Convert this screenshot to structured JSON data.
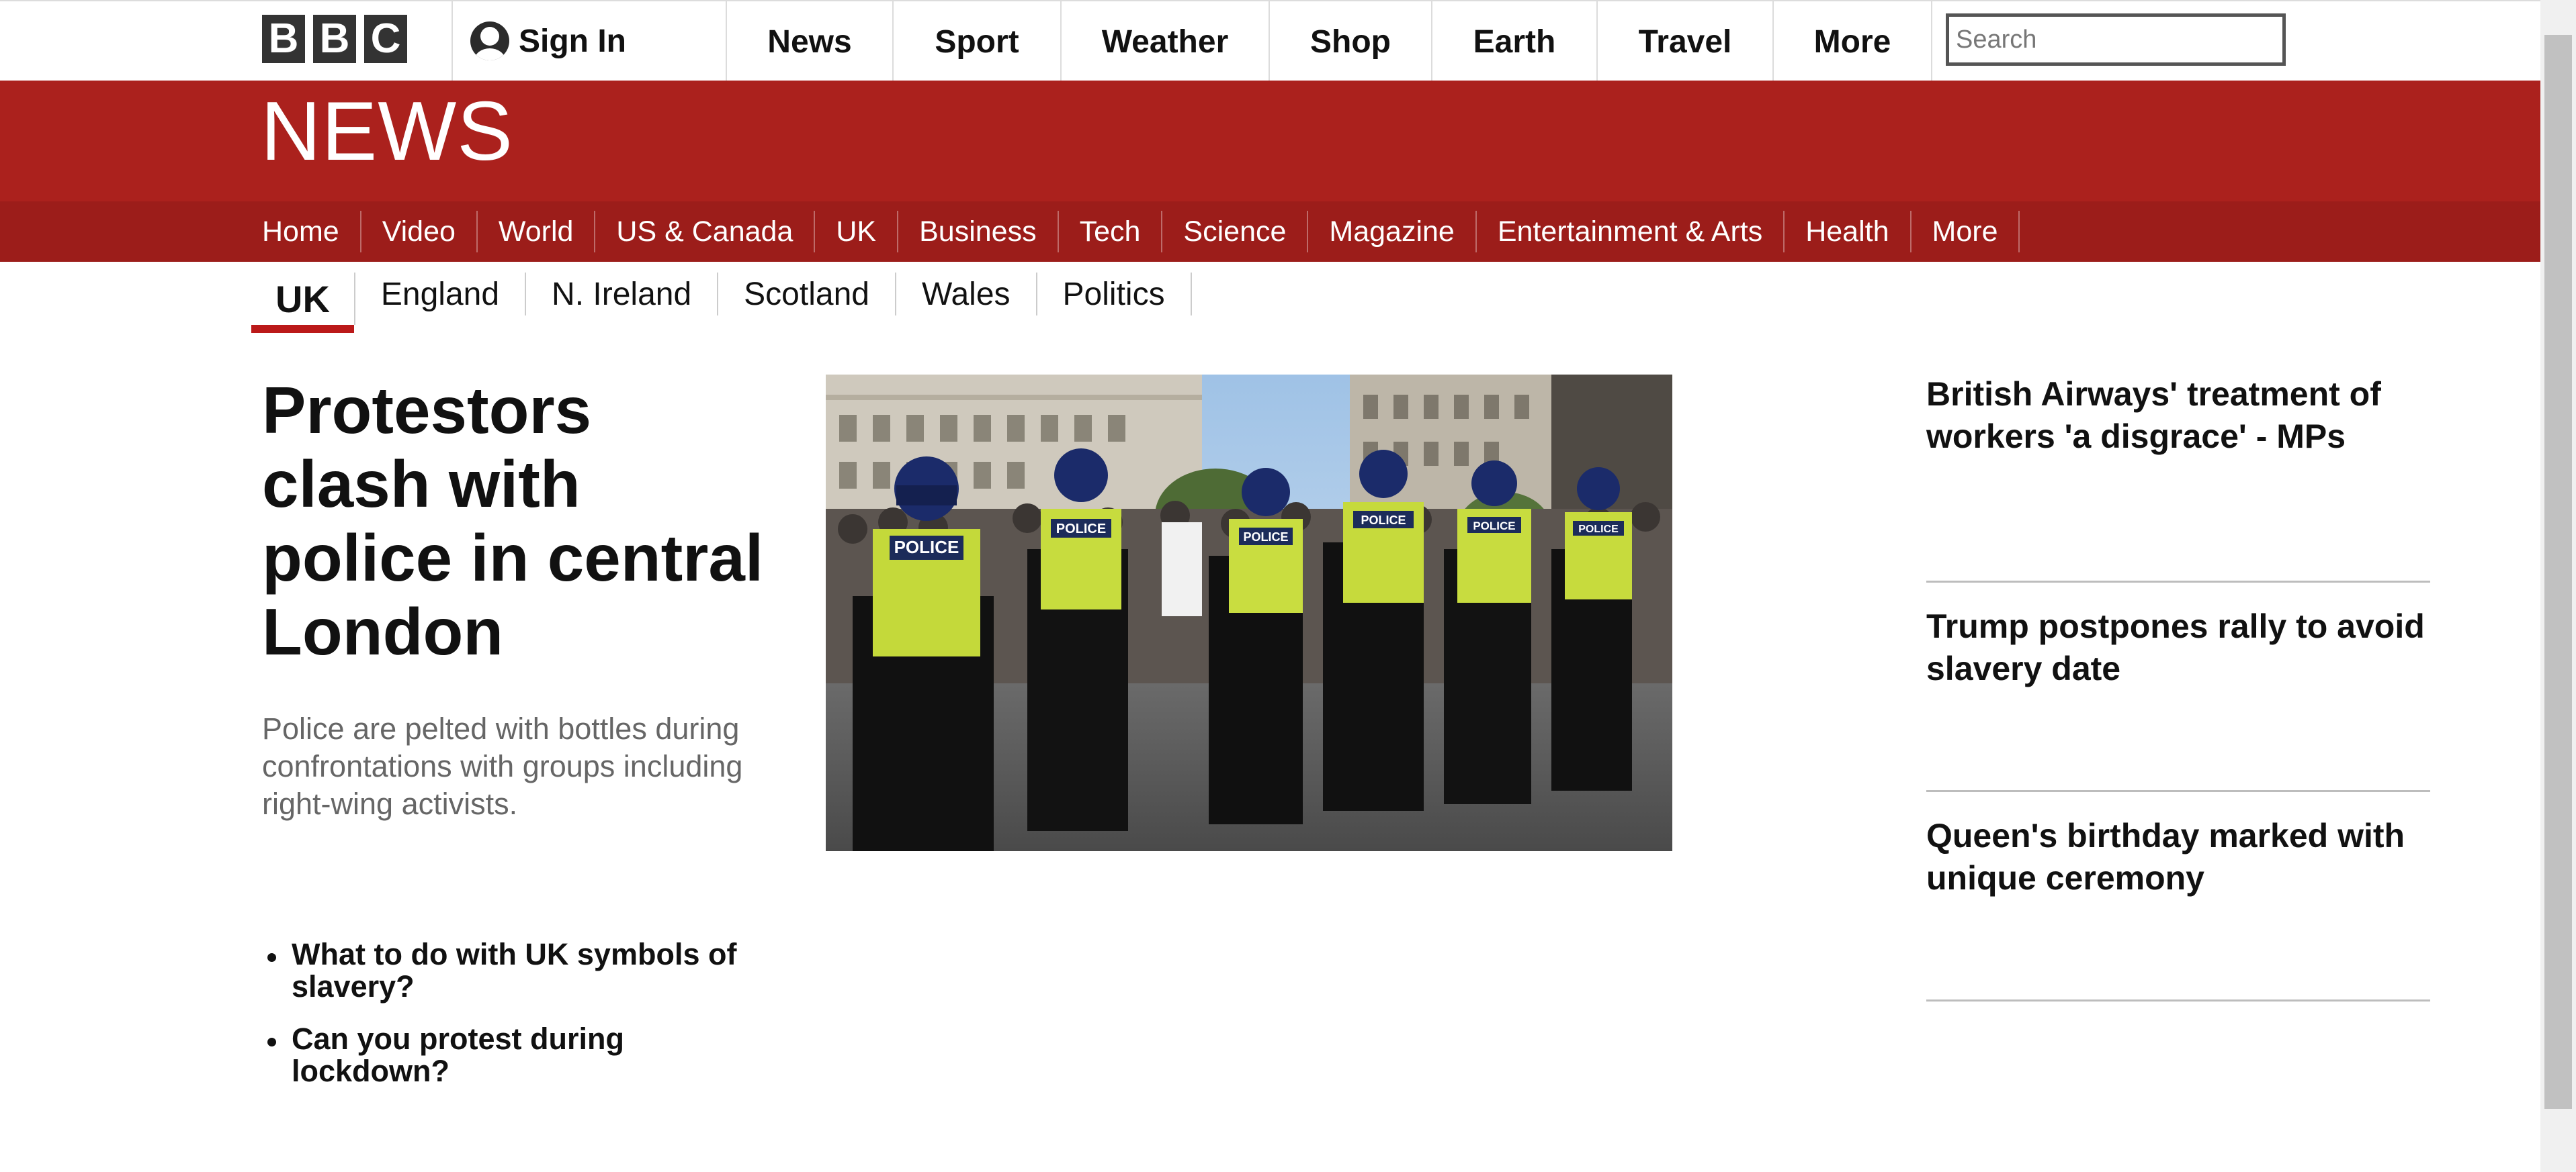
{
  "brand": {
    "logo_letters": [
      "B",
      "B",
      "C"
    ]
  },
  "top_nav": {
    "sign_in": "Sign In",
    "items": [
      "News",
      "Sport",
      "Weather",
      "Shop",
      "Earth",
      "Travel",
      "More"
    ],
    "search_placeholder": "Search"
  },
  "news_banner": {
    "title": "NEWS"
  },
  "news_nav": {
    "items": [
      "Home",
      "Video",
      "World",
      "US & Canada",
      "UK",
      "Business",
      "Tech",
      "Science",
      "Magazine",
      "Entertainment & Arts",
      "Health",
      "More"
    ]
  },
  "sub_nav": {
    "active": "UK",
    "items": [
      "England",
      "N. Ireland",
      "Scotland",
      "Wales",
      "Politics"
    ]
  },
  "main_story": {
    "headline": "Protestors clash with police in central London",
    "summary": "Police are pelted with bottles during confrontations with groups including right-wing activists.",
    "image_vests": [
      "POLICE",
      "POLICE",
      "POLICE",
      "POLICE",
      "POLICE",
      "POLICE"
    ],
    "related": [
      "What to do with UK symbols of slavery?",
      "Can you protest during lockdown?"
    ]
  },
  "side_stories": [
    "British Airways' treatment of workers 'a disgrace' - MPs",
    "Trump postpones rally to avoid slavery date",
    "Queen's birthday marked with unique ceremony"
  ],
  "colors": {
    "news_red": "#ab211d",
    "nav_red": "#9c1d1a",
    "active_underline": "#bb1919"
  }
}
